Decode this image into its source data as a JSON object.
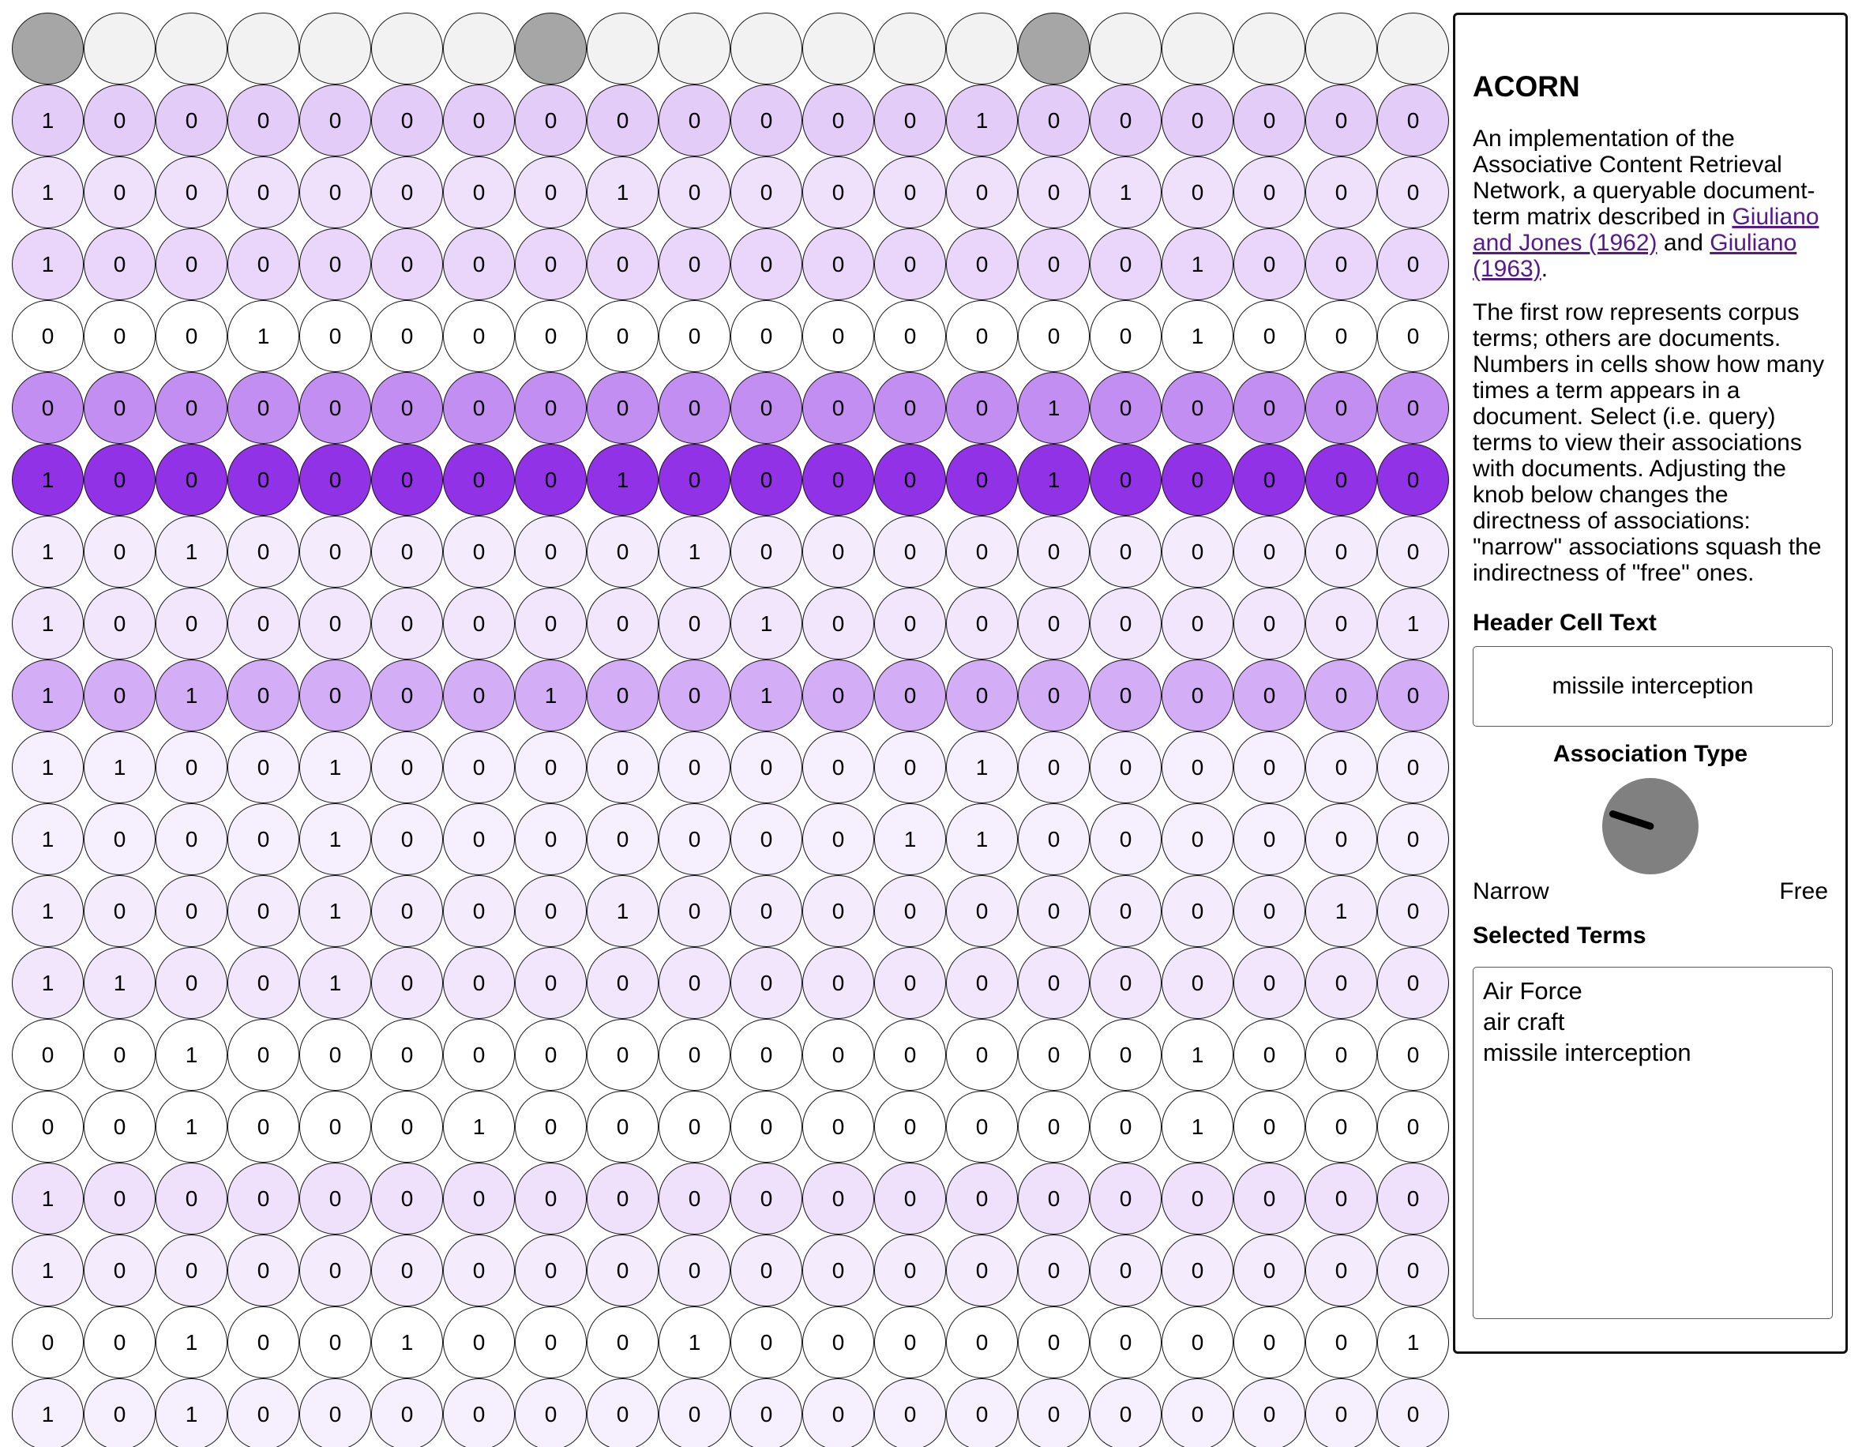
{
  "app": {
    "title": "ACORN",
    "description_1_prefix": "An implementation of the Associative Content Retrieval Network, a queryable document-term matrix described in ",
    "link_1": "Giuliano and Jones (1962)",
    "description_1_mid": " and ",
    "link_2": "Giuliano (1963)",
    "description_1_suffix": ".",
    "description_2": "The first row represents corpus terms; others are documents. Numbers in cells show how many times a term appears in a document. Select (i.e. query) terms to view their associations with documents. Adjusting the knob below changes the directness of associations: \"narrow\" associations squash the indirectness of \"free\" ones."
  },
  "header_cell": {
    "label": "Header Cell Text",
    "value": "missile interception"
  },
  "association": {
    "label": "Association Type",
    "narrow_label": "Narrow",
    "free_label": "Free",
    "knob_level": 0.2
  },
  "selected_terms": {
    "label": "Selected Terms",
    "items": [
      "Air Force",
      "air craft",
      "missile interception"
    ]
  },
  "matrix": {
    "header_selected": [
      1,
      0,
      0,
      0,
      0,
      0,
      0,
      1,
      0,
      0,
      0,
      0,
      0,
      0,
      1,
      0,
      0,
      0,
      0,
      0
    ],
    "rows": [
      {
        "activation": 0.25,
        "cells": [
          1,
          0,
          0,
          0,
          0,
          0,
          0,
          0,
          0,
          0,
          0,
          0,
          0,
          1,
          0,
          0,
          0,
          0,
          0,
          0
        ]
      },
      {
        "activation": 0.15,
        "cells": [
          1,
          0,
          0,
          0,
          0,
          0,
          0,
          0,
          1,
          0,
          0,
          0,
          0,
          0,
          0,
          1,
          0,
          0,
          0,
          0
        ]
      },
      {
        "activation": 0.2,
        "cells": [
          1,
          0,
          0,
          0,
          0,
          0,
          0,
          0,
          0,
          0,
          0,
          0,
          0,
          0,
          0,
          0,
          1,
          0,
          0,
          0
        ]
      },
      {
        "activation": 0.0,
        "cells": [
          0,
          0,
          0,
          1,
          0,
          0,
          0,
          0,
          0,
          0,
          0,
          0,
          0,
          0,
          0,
          0,
          1,
          0,
          0,
          0
        ]
      },
      {
        "activation": 0.55,
        "cells": [
          0,
          0,
          0,
          0,
          0,
          0,
          0,
          0,
          0,
          0,
          0,
          0,
          0,
          0,
          1,
          0,
          0,
          0,
          0,
          0
        ]
      },
      {
        "activation": 1.0,
        "cells": [
          1,
          0,
          0,
          0,
          0,
          0,
          0,
          0,
          1,
          0,
          0,
          0,
          0,
          0,
          1,
          0,
          0,
          0,
          0,
          0
        ]
      },
      {
        "activation": 0.1,
        "cells": [
          1,
          0,
          1,
          0,
          0,
          0,
          0,
          0,
          0,
          1,
          0,
          0,
          0,
          0,
          0,
          0,
          0,
          0,
          0,
          0
        ]
      },
      {
        "activation": 0.12,
        "cells": [
          1,
          0,
          0,
          0,
          0,
          0,
          0,
          0,
          0,
          0,
          1,
          0,
          0,
          0,
          0,
          0,
          0,
          0,
          0,
          1
        ]
      },
      {
        "activation": 0.4,
        "cells": [
          1,
          0,
          1,
          0,
          0,
          0,
          0,
          1,
          0,
          0,
          1,
          0,
          0,
          0,
          0,
          0,
          0,
          0,
          0,
          0
        ]
      },
      {
        "activation": 0.08,
        "cells": [
          1,
          1,
          0,
          0,
          1,
          0,
          0,
          0,
          0,
          0,
          0,
          0,
          0,
          1,
          0,
          0,
          0,
          0,
          0,
          0
        ]
      },
      {
        "activation": 0.08,
        "cells": [
          1,
          0,
          0,
          0,
          1,
          0,
          0,
          0,
          0,
          0,
          0,
          0,
          1,
          1,
          0,
          0,
          0,
          0,
          0,
          0
        ]
      },
      {
        "activation": 0.1,
        "cells": [
          1,
          0,
          0,
          0,
          1,
          0,
          0,
          0,
          1,
          0,
          0,
          0,
          0,
          0,
          0,
          0,
          0,
          0,
          1,
          0
        ]
      },
      {
        "activation": 0.12,
        "cells": [
          1,
          1,
          0,
          0,
          1,
          0,
          0,
          0,
          0,
          0,
          0,
          0,
          0,
          0,
          0,
          0,
          0,
          0,
          0,
          0
        ]
      },
      {
        "activation": 0.0,
        "cells": [
          0,
          0,
          1,
          0,
          0,
          0,
          0,
          0,
          0,
          0,
          0,
          0,
          0,
          0,
          0,
          0,
          1,
          0,
          0,
          0
        ]
      },
      {
        "activation": 0.0,
        "cells": [
          0,
          0,
          1,
          0,
          0,
          0,
          1,
          0,
          0,
          0,
          0,
          0,
          0,
          0,
          0,
          0,
          1,
          0,
          0,
          0
        ]
      },
      {
        "activation": 0.15,
        "cells": [
          1,
          0,
          0,
          0,
          0,
          0,
          0,
          0,
          0,
          0,
          0,
          0,
          0,
          0,
          0,
          0,
          0,
          0,
          0,
          0
        ]
      },
      {
        "activation": 0.1,
        "cells": [
          1,
          0,
          0,
          0,
          0,
          0,
          0,
          0,
          0,
          0,
          0,
          0,
          0,
          0,
          0,
          0,
          0,
          0,
          0,
          0
        ]
      },
      {
        "activation": 0.0,
        "cells": [
          0,
          0,
          1,
          0,
          0,
          1,
          0,
          0,
          0,
          1,
          0,
          0,
          0,
          0,
          0,
          0,
          0,
          0,
          0,
          1
        ]
      },
      {
        "activation": 0.08,
        "cells": [
          1,
          0,
          1,
          0,
          0,
          0,
          0,
          0,
          0,
          0,
          0,
          0,
          0,
          0,
          0,
          0,
          0,
          0,
          0,
          0
        ]
      }
    ]
  },
  "colors": {
    "header_cell": "#f2f2f2",
    "header_cell_selected": "#a6a6a6",
    "accent_purple": "#9232e6",
    "link": "#551a8b",
    "knob": "#808080"
  }
}
